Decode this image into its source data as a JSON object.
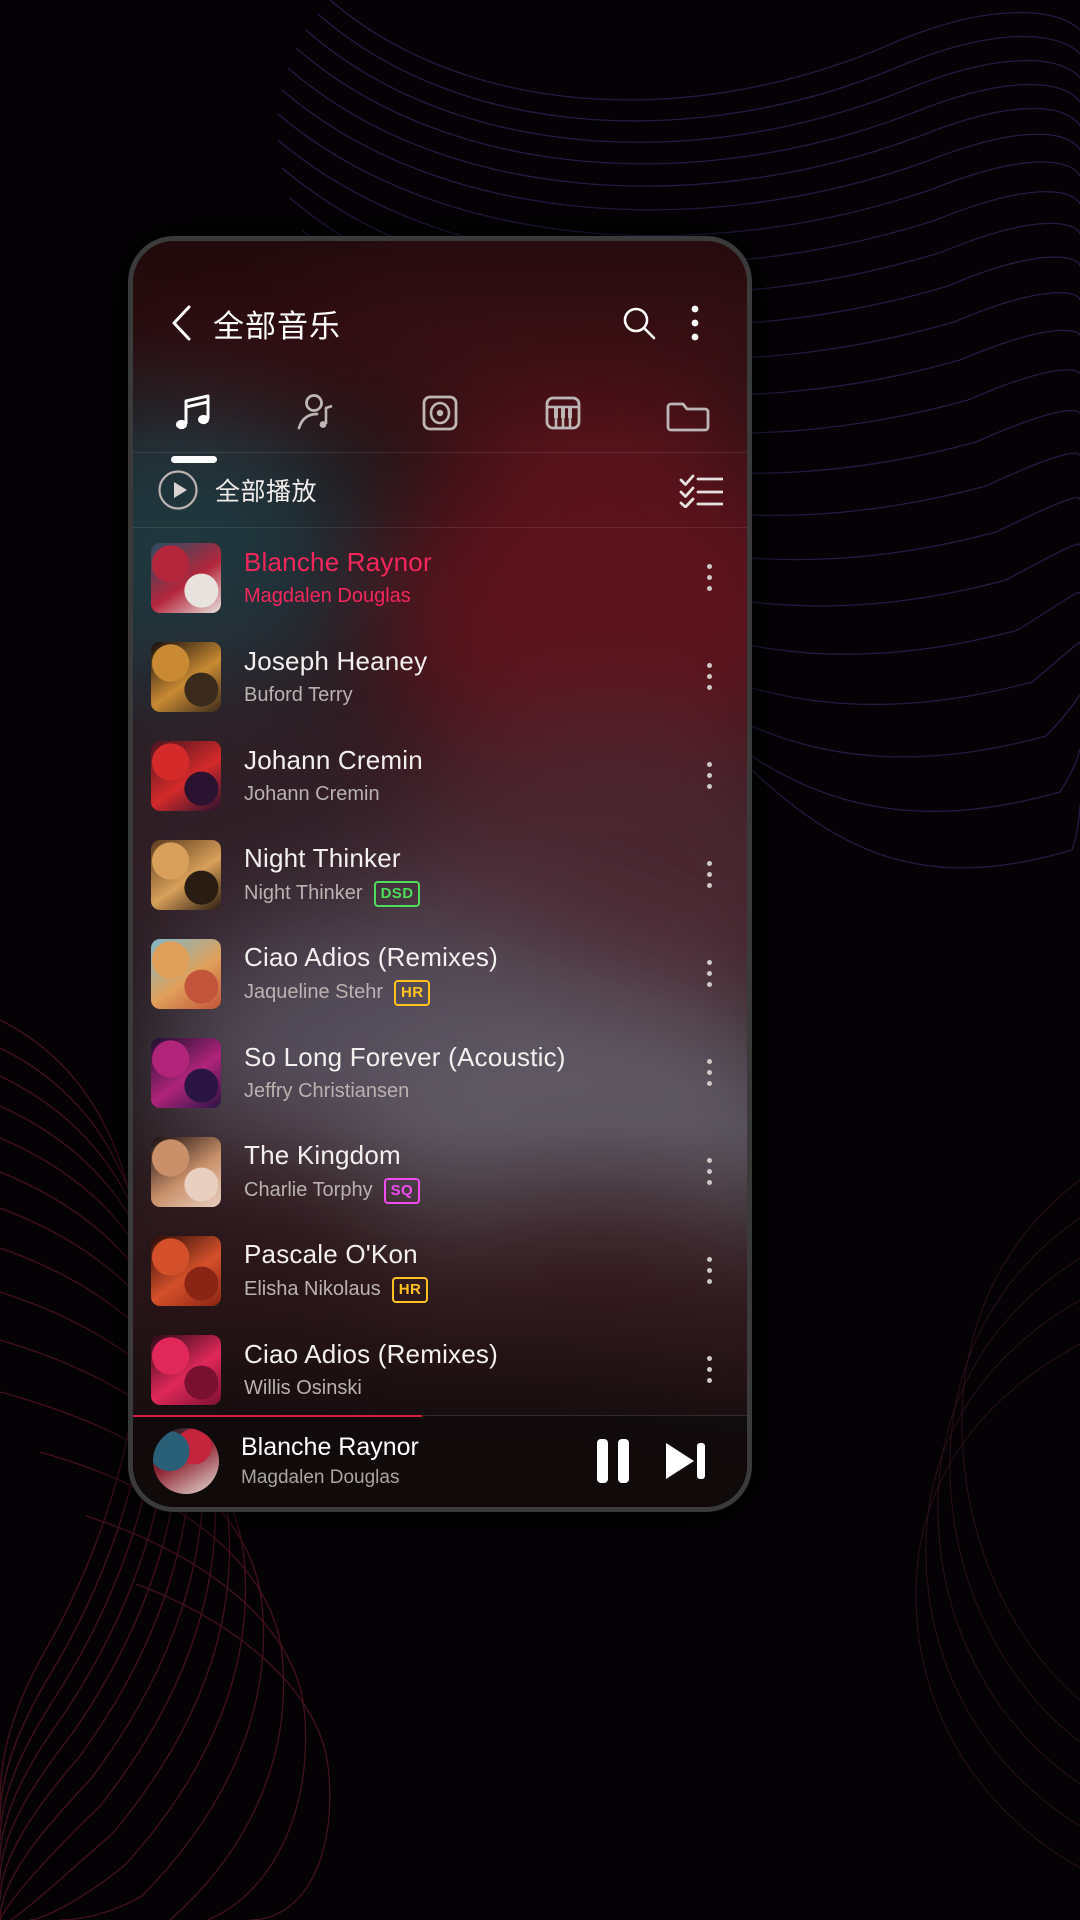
{
  "app": {
    "header": {
      "title": "全部音乐",
      "back_icon": "chevron-left-icon",
      "search_icon": "search-icon",
      "overflow_icon": "more-vertical-icon"
    },
    "tabs": [
      {
        "id": "songs",
        "icon": "music-note-icon",
        "active": true
      },
      {
        "id": "artists",
        "icon": "artist-icon",
        "active": false
      },
      {
        "id": "albums",
        "icon": "album-disc-icon",
        "active": false
      },
      {
        "id": "genres",
        "icon": "piano-keys-icon",
        "active": false
      },
      {
        "id": "folders",
        "icon": "folder-icon",
        "active": false
      }
    ],
    "play_all": {
      "label": "全部播放",
      "play_icon": "play-circle-icon",
      "multiselect_icon": "checklist-icon"
    },
    "songs": [
      {
        "title": "Blanche Raynor",
        "artist": "Magdalen Douglas",
        "badge": null,
        "playing": true,
        "art": [
          "#2a4d63",
          "#b4263c",
          "#e8e3de"
        ]
      },
      {
        "title": "Joseph Heaney",
        "artist": "Buford Terry",
        "badge": null,
        "playing": false,
        "art": [
          "#120d0c",
          "#c98a33",
          "#3a2a1c"
        ]
      },
      {
        "title": "Johann Cremin",
        "artist": "Johann Cremin",
        "badge": null,
        "playing": false,
        "art": [
          "#4a1420",
          "#d42a2a",
          "#2a1230"
        ]
      },
      {
        "title": "Night Thinker",
        "artist": "Night Thinker",
        "badge": "DSD",
        "playing": false,
        "art": [
          "#5c3a1c",
          "#d8a05a",
          "#2a1c12"
        ]
      },
      {
        "title": "Ciao Adios (Remixes)",
        "artist": "Jaqueline Stehr",
        "badge": "HR",
        "playing": false,
        "art": [
          "#7fb8c8",
          "#e0a05a",
          "#c2543a"
        ]
      },
      {
        "title": "So Long Forever (Acoustic)",
        "artist": "Jeffry Christiansen",
        "badge": null,
        "playing": false,
        "art": [
          "#1c1030",
          "#b0247a",
          "#2a1444"
        ]
      },
      {
        "title": "The Kingdom",
        "artist": "Charlie Torphy",
        "badge": "SQ",
        "playing": false,
        "art": [
          "#160e10",
          "#c9906a",
          "#e8cfc0"
        ]
      },
      {
        "title": "Pascale O'Kon",
        "artist": "Elisha Nikolaus",
        "badge": "HR",
        "playing": false,
        "art": [
          "#2a0c08",
          "#d4502a",
          "#8a2414"
        ]
      },
      {
        "title": "Ciao Adios (Remixes)",
        "artist": "Willis Osinski",
        "badge": null,
        "playing": false,
        "art": [
          "#2a0a16",
          "#e0285a",
          "#7a1030"
        ]
      }
    ],
    "badge_colors": {
      "DSD": "#4ddd5a",
      "HR": "#ffc220",
      "SQ": "#ef4df0"
    },
    "now_playing": {
      "title": "Blanche Raynor",
      "artist": "Magdalen Douglas",
      "pause_icon": "pause-icon",
      "next_icon": "skip-next-icon",
      "progress_percent": 47,
      "accent": "#cf2040"
    }
  }
}
